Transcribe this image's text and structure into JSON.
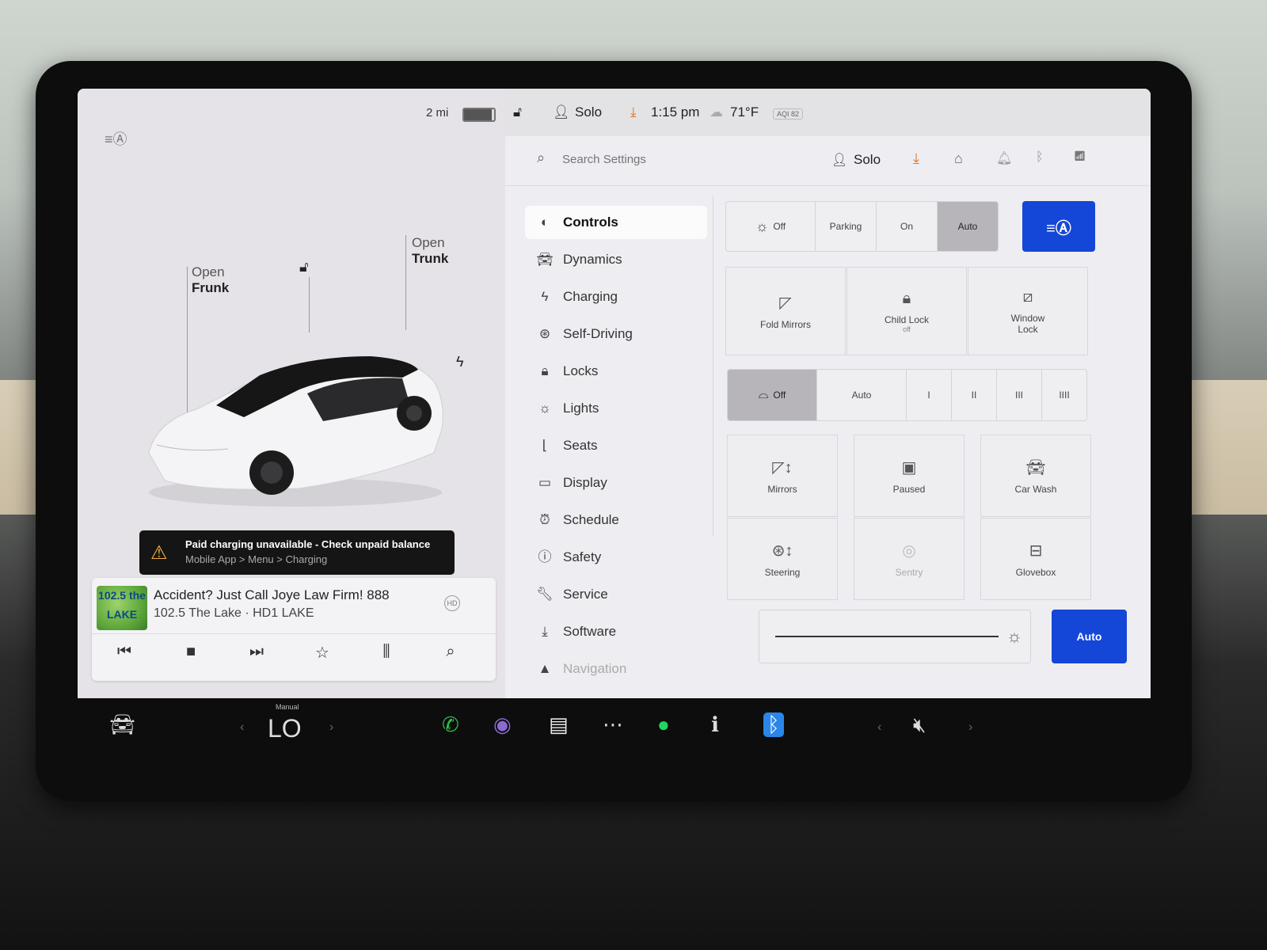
{
  "left": {
    "range": "2 mi",
    "callouts": {
      "frunk_line1": "Open",
      "frunk_line2": "Frunk",
      "trunk_line1": "Open",
      "trunk_line2": "Trunk"
    },
    "alert": {
      "title": "Paid charging unavailable - Check unpaid balance",
      "path": "Mobile App > Menu > Charging"
    },
    "media": {
      "logo_text": "102.5 the LAKE",
      "song": "Accident? Just Call Joye Law Firm! 888",
      "station": "102.5 The Lake · HD1 LAKE",
      "hd_badge": "HD"
    }
  },
  "statusbar": {
    "profile": "Solo",
    "time": "1:15 pm",
    "temperature": "71°F",
    "aqi": "AQI 82"
  },
  "settings": {
    "search_placeholder": "Search Settings",
    "profile": "Solo",
    "nav": [
      {
        "label": "Controls",
        "icon": "toggle-icon"
      },
      {
        "label": "Dynamics",
        "icon": "car-icon"
      },
      {
        "label": "Charging",
        "icon": "bolt-icon"
      },
      {
        "label": "Self-Driving",
        "icon": "steering-wheel-icon"
      },
      {
        "label": "Locks",
        "icon": "lock-icon"
      },
      {
        "label": "Lights",
        "icon": "bulb-icon"
      },
      {
        "label": "Seats",
        "icon": "seat-icon"
      },
      {
        "label": "Display",
        "icon": "display-icon"
      },
      {
        "label": "Schedule",
        "icon": "clock-icon"
      },
      {
        "label": "Safety",
        "icon": "alert-icon"
      },
      {
        "label": "Service",
        "icon": "wrench-icon"
      },
      {
        "label": "Software",
        "icon": "download-icon"
      },
      {
        "label": "Navigation",
        "icon": "navigation-icon"
      }
    ],
    "lights": [
      "Off",
      "Parking",
      "On",
      "Auto"
    ],
    "lights_selected": "Auto",
    "tiles_row1": [
      {
        "label": "Fold Mirrors",
        "sub": ""
      },
      {
        "label": "Child Lock",
        "sub": "off"
      },
      {
        "label": "Window Lock",
        "sub": ""
      }
    ],
    "wipers": [
      "Off",
      "Auto",
      "I",
      "II",
      "III",
      "IIII"
    ],
    "wipers_selected": "Off",
    "tiles_grid": [
      {
        "label": "Mirrors"
      },
      {
        "label": "Paused"
      },
      {
        "label": "Car Wash"
      },
      {
        "label": "Steering"
      },
      {
        "label": "Sentry"
      },
      {
        "label": "Glovebox"
      }
    ],
    "brightness_button": "Auto",
    "accent": "#1446d8"
  },
  "dock": {
    "climate_mode": "Manual",
    "temperature": "LO"
  }
}
